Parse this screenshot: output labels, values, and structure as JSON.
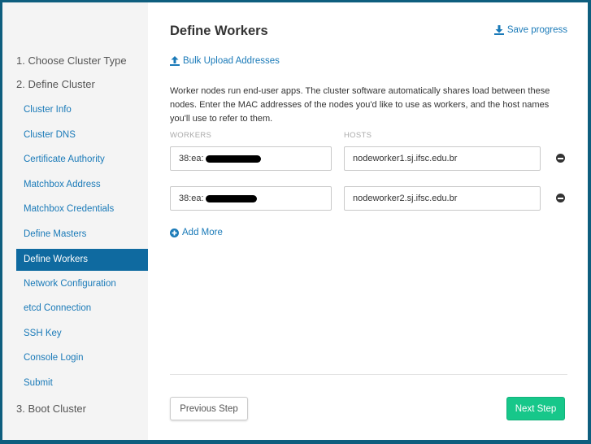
{
  "sidebar": {
    "steps": [
      {
        "label": "1. Choose Cluster Type"
      },
      {
        "label": "2. Define Cluster"
      },
      {
        "label": "3. Boot Cluster"
      }
    ],
    "substeps": [
      {
        "label": "Cluster Info"
      },
      {
        "label": "Cluster DNS"
      },
      {
        "label": "Certificate Authority"
      },
      {
        "label": "Matchbox Address"
      },
      {
        "label": "Matchbox Credentials"
      },
      {
        "label": "Define Masters"
      },
      {
        "label": "Define Workers",
        "active": true
      },
      {
        "label": "Network Configuration"
      },
      {
        "label": "etcd Connection"
      },
      {
        "label": "SSH Key"
      },
      {
        "label": "Console Login"
      },
      {
        "label": "Submit"
      }
    ]
  },
  "main": {
    "title": "Define Workers",
    "save_label": "Save progress",
    "bulk_label": "Bulk Upload Addresses",
    "description": "Worker nodes run end-user apps. The cluster software automatically shares load between these nodes. Enter the MAC addresses of the nodes you'd like to use as workers, and the host names you'll use to refer to them.",
    "workers_header": "WORKERS",
    "hosts_header": "HOSTS",
    "rows": [
      {
        "mac": "38:ea:",
        "host": "nodeworker1.sj.ifsc.edu.br"
      },
      {
        "mac": "38:ea:",
        "host": "nodeworker2.sj.ifsc.edu.br"
      }
    ],
    "add_more_label": "Add More",
    "prev_label": "Previous Step",
    "next_label": "Next Step"
  },
  "colors": {
    "accent": "#1a7ab8",
    "active_bg": "#0f6aa0",
    "next_button": "#17c78a",
    "sidebar_bg": "#f4f4f4"
  }
}
